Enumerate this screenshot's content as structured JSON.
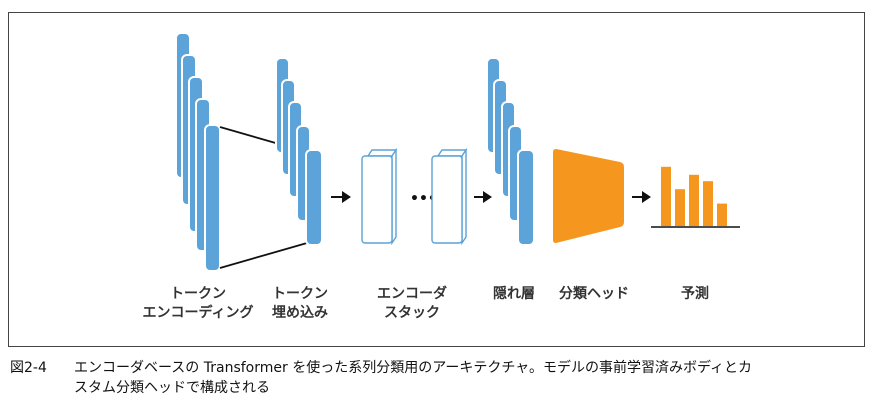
{
  "labels": {
    "token_encoding": [
      "トークン",
      "エンコーディング"
    ],
    "token_embedding": [
      "トークン",
      "埋め込み"
    ],
    "encoder_stack": [
      "エンコーダ",
      "スタック"
    ],
    "hidden_states": "隠れ層",
    "classification_head": "分類ヘッド",
    "predictions": "予測"
  },
  "ellipsis": "•••",
  "caption": {
    "number": "図2-4",
    "line1": "エンコーダベースの Transformer を使った系列分類用のアーキテクチャ。モデルの事前学習済みボディとカ",
    "line2": "スタム分類ヘッドで構成される"
  },
  "colors": {
    "blue": "#5ba3d9",
    "blue_stroke": "#4a8fc2",
    "orange": "#f5961e",
    "arrow": "#111111",
    "encoder_outline": "#5ba3d9"
  },
  "prediction_bars": [
    0.74,
    0.46,
    0.64,
    0.56,
    0.28
  ]
}
